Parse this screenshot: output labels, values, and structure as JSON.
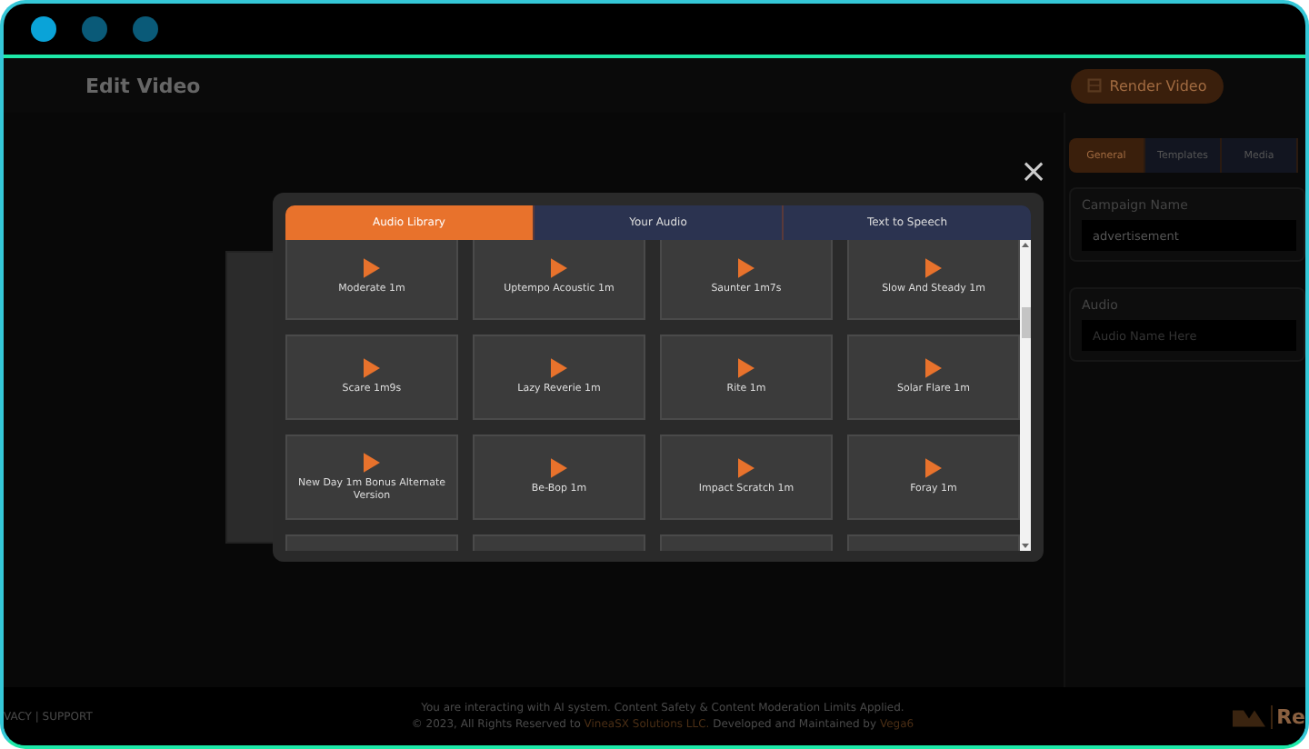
{
  "window": {
    "controls": [
      {
        "color": "#0aa3d8"
      },
      {
        "color": "#0a5a78"
      },
      {
        "color": "#0a5a78"
      }
    ]
  },
  "header": {
    "title": "Edit Video",
    "render_button": "Render Video"
  },
  "settings_panel": {
    "tabs": [
      {
        "label": "General",
        "selected": true
      },
      {
        "label": "Templates",
        "selected": false
      },
      {
        "label": "Media",
        "selected": false
      }
    ],
    "fields": [
      {
        "label": "Campaign Name",
        "value": "advertisement"
      },
      {
        "label": "Audio",
        "placeholder": "Audio Name Here"
      }
    ]
  },
  "audio_dialog": {
    "close": "×",
    "tabs": [
      {
        "label": "Audio Library",
        "selected": true
      },
      {
        "label": "Your Audio",
        "selected": false
      },
      {
        "label": "Text to Speech",
        "selected": false
      }
    ],
    "tracks": [
      {
        "kind": "track",
        "title": "Moderate 1m"
      },
      {
        "kind": "track",
        "title": "Uptempo Acoustic 1m"
      },
      {
        "kind": "track",
        "title": "Saunter 1m7s"
      },
      {
        "kind": "track",
        "title": "Slow And Steady 1m"
      },
      {
        "kind": "track",
        "title": "Scare 1m9s"
      },
      {
        "kind": "track",
        "title": "Lazy Reverie 1m"
      },
      {
        "kind": "track",
        "title": "Rite 1m"
      },
      {
        "kind": "track",
        "title": "Solar Flare 1m"
      },
      {
        "kind": "track",
        "title": "New Day 1m Bonus Alternate Version"
      },
      {
        "kind": "track",
        "title": "Be-Bop 1m"
      },
      {
        "kind": "track",
        "title": "Impact Scratch 1m"
      },
      {
        "kind": "track",
        "title": "Foray 1m"
      },
      {
        "kind": "cut"
      },
      {
        "kind": "cut"
      },
      {
        "kind": "cut"
      },
      {
        "kind": "cut"
      }
    ]
  },
  "footer": {
    "links": "VACY | SUPPORT",
    "notice": "You are interacting with AI system. Content Safety & Content Moderation Limits Applied.",
    "copyright": "© 2023, All Rights Reserved to",
    "company": "VineaSX Solutions LLC.",
    "maintained": "Developed and Maintained by",
    "developer": "Vega6",
    "logo_text": "Re"
  }
}
